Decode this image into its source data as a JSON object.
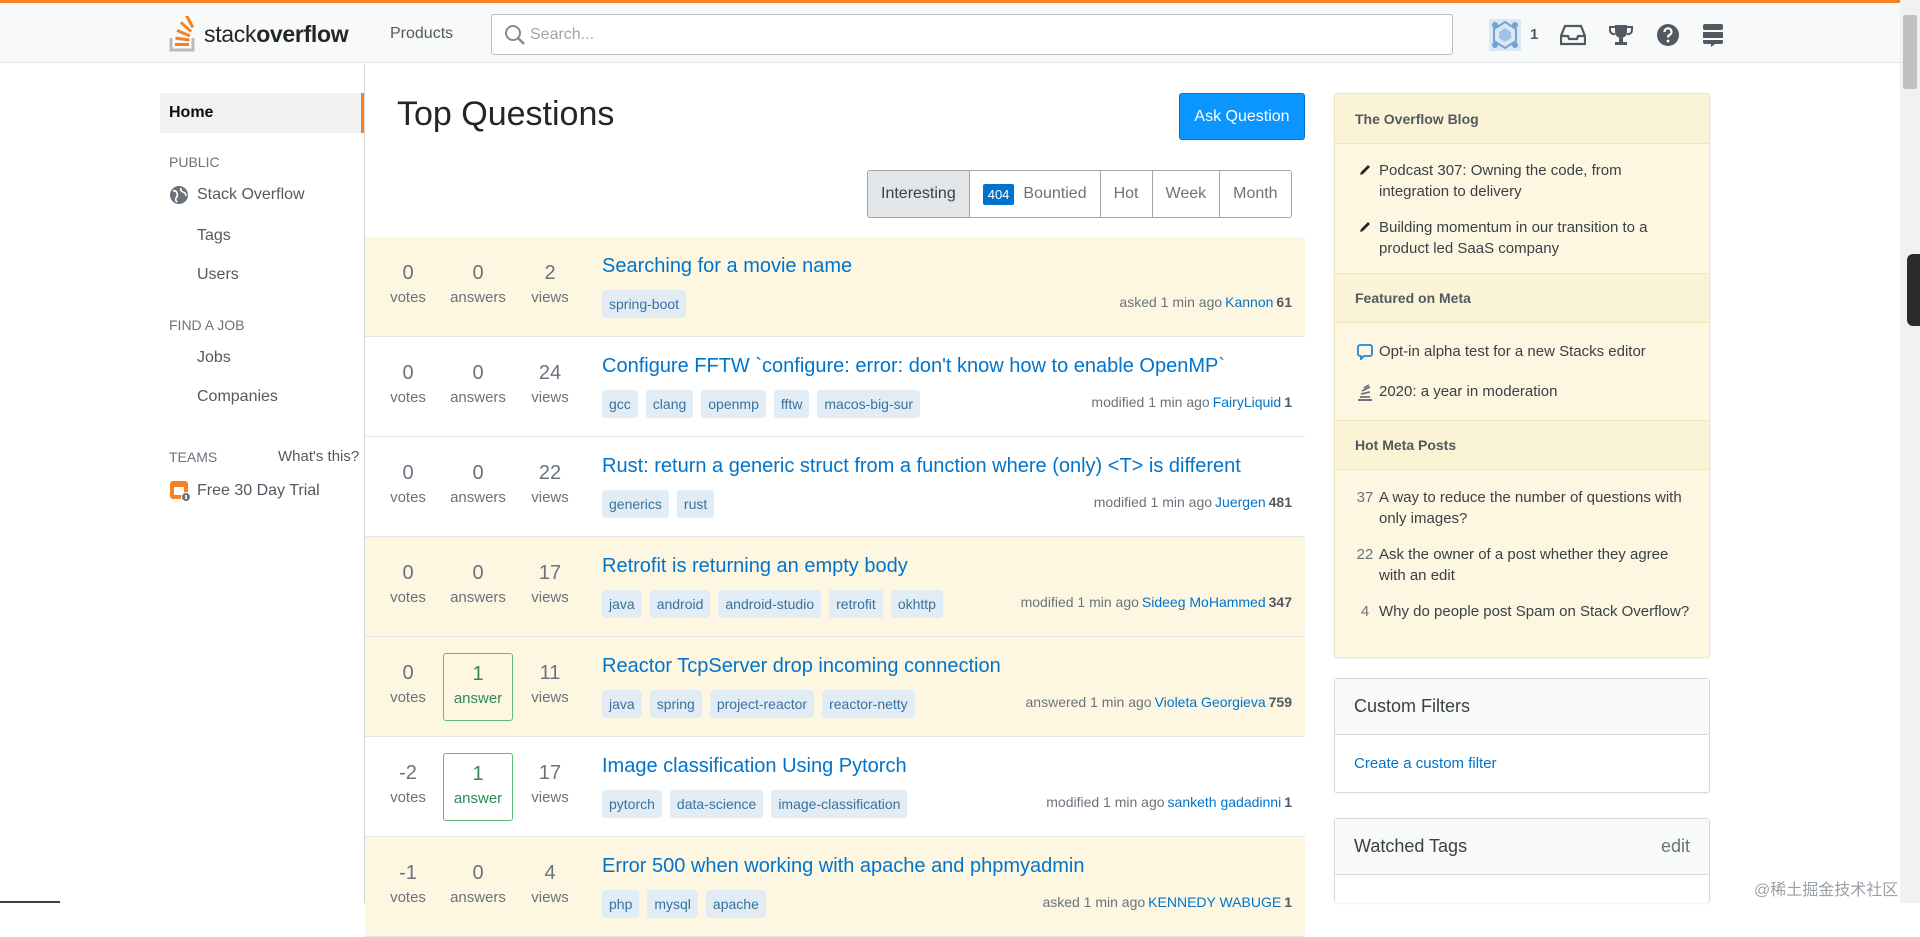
{
  "topbar": {
    "logo_light": "stack",
    "logo_bold": "overflow",
    "products": "Products",
    "search_placeholder": "Search...",
    "reputation": "1"
  },
  "leftnav": {
    "home": "Home",
    "public_heading": "PUBLIC",
    "stack_overflow": "Stack Overflow",
    "tags": "Tags",
    "users": "Users",
    "find_job_heading": "FIND A JOB",
    "jobs": "Jobs",
    "companies": "Companies",
    "teams_heading": "TEAMS",
    "whats_this": "What's this?",
    "free_trial": "Free 30 Day Trial"
  },
  "main": {
    "title": "Top Questions",
    "ask_button": "Ask Question",
    "filters": {
      "interesting": "Interesting",
      "bountied_count": "404",
      "bountied": "Bountied",
      "hot": "Hot",
      "week": "Week",
      "month": "Month"
    },
    "stat_labels": {
      "votes": "votes",
      "answers": "answers",
      "answer": "answer",
      "views": "views"
    },
    "questions": [
      {
        "votes": "0",
        "answers": "0",
        "answers_label": "answers",
        "views": "2",
        "title": "Searching for a movie name",
        "tags": [
          "spring-boot"
        ],
        "action": "asked 1 min ago",
        "user": "Kannon",
        "rep": "61"
      },
      {
        "votes": "0",
        "answers": "0",
        "answers_label": "answers",
        "views": "24",
        "title": "Configure FFTW `configure: error: don't know how to enable OpenMP`",
        "tags": [
          "gcc",
          "clang",
          "openmp",
          "fftw",
          "macos-big-sur"
        ],
        "action": "modified 1 min ago",
        "user": "FairyLiquid",
        "rep": "1"
      },
      {
        "votes": "0",
        "answers": "0",
        "answers_label": "answers",
        "views": "22",
        "title": "Rust: return a generic struct from a function where (only) <T> is different",
        "tags": [
          "generics",
          "rust"
        ],
        "action": "modified 1 min ago",
        "user": "Juergen",
        "rep": "481"
      },
      {
        "votes": "0",
        "answers": "0",
        "answers_label": "answers",
        "views": "17",
        "title": "Retrofit is returning an empty body",
        "tags": [
          "java",
          "android",
          "android-studio",
          "retrofit",
          "okhttp"
        ],
        "action": "modified 1 min ago",
        "user": "Sideeg MoHammed",
        "rep": "347"
      },
      {
        "votes": "0",
        "answers": "1",
        "answers_label": "answer",
        "views": "11",
        "title": "Reactor TcpServer drop incoming connection",
        "tags": [
          "java",
          "spring",
          "project-reactor",
          "reactor-netty"
        ],
        "action": "answered 1 min ago",
        "user": "Violeta Georgieva",
        "rep": "759"
      },
      {
        "votes": "-2",
        "answers": "1",
        "answers_label": "answer",
        "views": "17",
        "title": "Image classification Using Pytorch",
        "tags": [
          "pytorch",
          "data-science",
          "image-classification"
        ],
        "action": "modified 1 min ago",
        "user": "sanketh gadadinni",
        "rep": "1"
      },
      {
        "votes": "-1",
        "answers": "0",
        "answers_label": "answers",
        "views": "4",
        "title": "Error 500 when working with apache and phpmyadmin",
        "tags": [
          "php",
          "mysql",
          "apache"
        ],
        "action": "asked 1 min ago",
        "user": "KENNEDY WABUGE",
        "rep": "1"
      }
    ]
  },
  "sidebar": {
    "blog_heading": "The Overflow Blog",
    "blog_items": [
      "Podcast 307: Owning the code, from integration to delivery",
      "Building momentum in our transition to a product led SaaS company"
    ],
    "meta_heading": "Featured on Meta",
    "meta_items": [
      "Opt-in alpha test for a new Stacks editor",
      "2020: a year in moderation"
    ],
    "hot_heading": "Hot Meta Posts",
    "hot_items": [
      {
        "count": "37",
        "text": "A way to reduce the number of questions with only images?"
      },
      {
        "count": "22",
        "text": "Ask the owner of a post whether they agree with an edit"
      },
      {
        "count": "4",
        "text": "Why do people post Spam on Stack Overflow?"
      }
    ],
    "custom_filters": {
      "title": "Custom Filters",
      "link": "Create a custom filter"
    },
    "watched_tags": {
      "title": "Watched Tags",
      "edit": "edit"
    }
  },
  "watermark": "@稀土掘金技术社区",
  "colors": {
    "accent": "#f48225",
    "link": "#0074cc",
    "primary_button": "#0a95ff",
    "highlight_row": "#fdf7e2",
    "answered": "#2e8b57"
  }
}
